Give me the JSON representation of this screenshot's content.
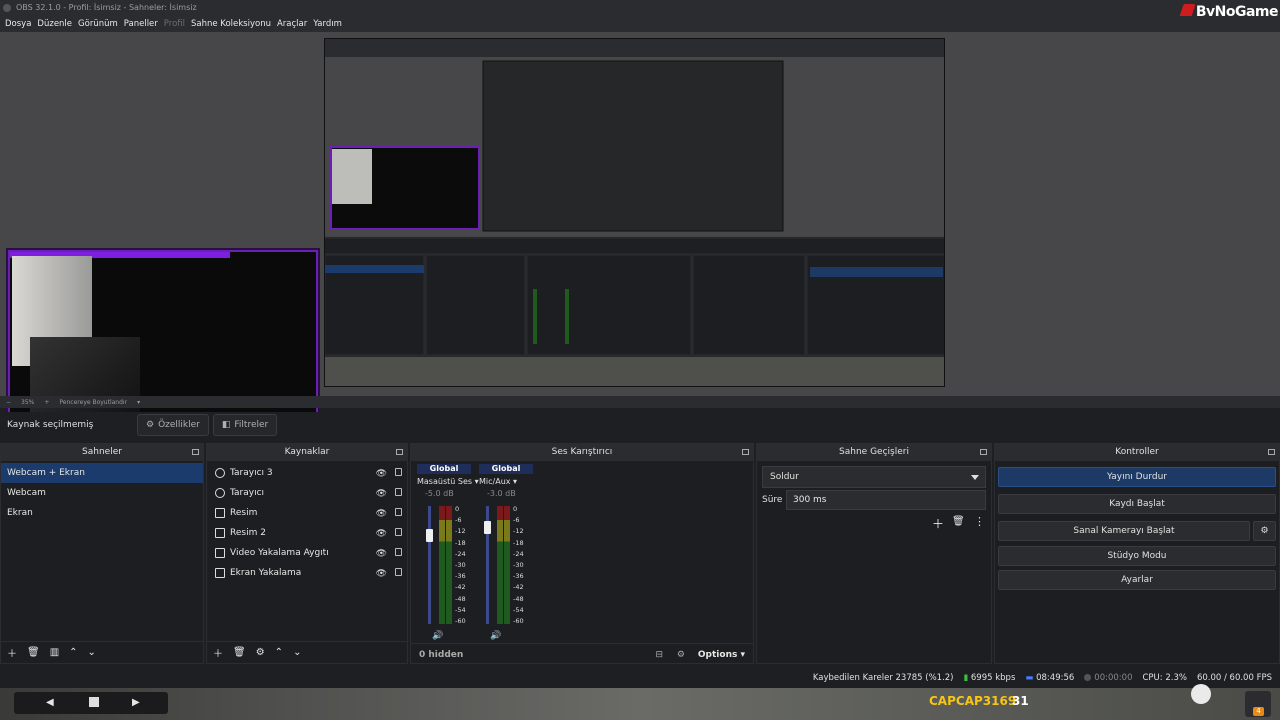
{
  "window": {
    "title": "OBS 32.1.0 - Profil: İsimsiz - Sahneler: İsimsiz",
    "brand": "ByNoGame"
  },
  "menu": [
    "Dosya",
    "Düzenle",
    "Görünüm",
    "Paneller",
    "Profil",
    "Sahne Koleksiyonu",
    "Araçlar",
    "Yardım"
  ],
  "menu_disabled": [
    "Profil"
  ],
  "preview_status": {
    "zoom": "35%",
    "resize": "Pencereye Boyutlandır"
  },
  "source_bar": {
    "label": "Kaynak seçilmemiş",
    "properties": "Özellikler",
    "filters": "Filtreler"
  },
  "docks": {
    "scenes": {
      "title": "Sahneler",
      "items": [
        "Webcam + Ekran",
        "Webcam",
        "Ekran"
      ],
      "selected": 0
    },
    "sources": {
      "title": "Kaynaklar",
      "items": [
        {
          "label": "Tarayıcı 3",
          "icon": "browser-icon"
        },
        {
          "label": "Tarayıcı",
          "icon": "browser-icon"
        },
        {
          "label": "Resim",
          "icon": "image-icon"
        },
        {
          "label": "Resim 2",
          "icon": "image-icon"
        },
        {
          "label": "Video Yakalama Aygıtı",
          "icon": "camera-icon"
        },
        {
          "label": "Ekran Yakalama",
          "icon": "monitor-icon"
        }
      ]
    },
    "mixer": {
      "title": "Ses Karıştırıcı",
      "channels": [
        {
          "badge": "Global",
          "name": "Masaüstü Ses",
          "db": "-5.0 dB"
        },
        {
          "badge": "Global",
          "name": "Mic/Aux",
          "db": "-3.0 dB"
        }
      ],
      "ticks": [
        "0",
        "-6",
        "-12",
        "-18",
        "-24",
        "-30",
        "-36",
        "-42",
        "-48",
        "-54",
        "-60"
      ],
      "hidden": "0 hidden",
      "options": "Options"
    },
    "transitions": {
      "title": "Sahne Geçişleri",
      "selected": "Soldur",
      "duration_label": "Süre",
      "duration": "300 ms"
    },
    "controls": {
      "title": "Kontroller",
      "buttons": [
        "Yayını Durdur",
        "Kaydı Başlat",
        "Sanal Kamerayı Başlat",
        "Stüdyo Modu",
        "Ayarlar"
      ]
    }
  },
  "status": {
    "dropped": "Kaybedilen Kareler 23785 (%1.2)",
    "bitrate": "6995 kbps",
    "stream_time": "08:49:56",
    "rec_time": "00:00:00",
    "cpu": "CPU: 2.3%",
    "fps": "60.00 / 60.00 FPS"
  },
  "overlay": {
    "streamer": "CAPCAP3169",
    "number": "31",
    "badge": "4"
  }
}
